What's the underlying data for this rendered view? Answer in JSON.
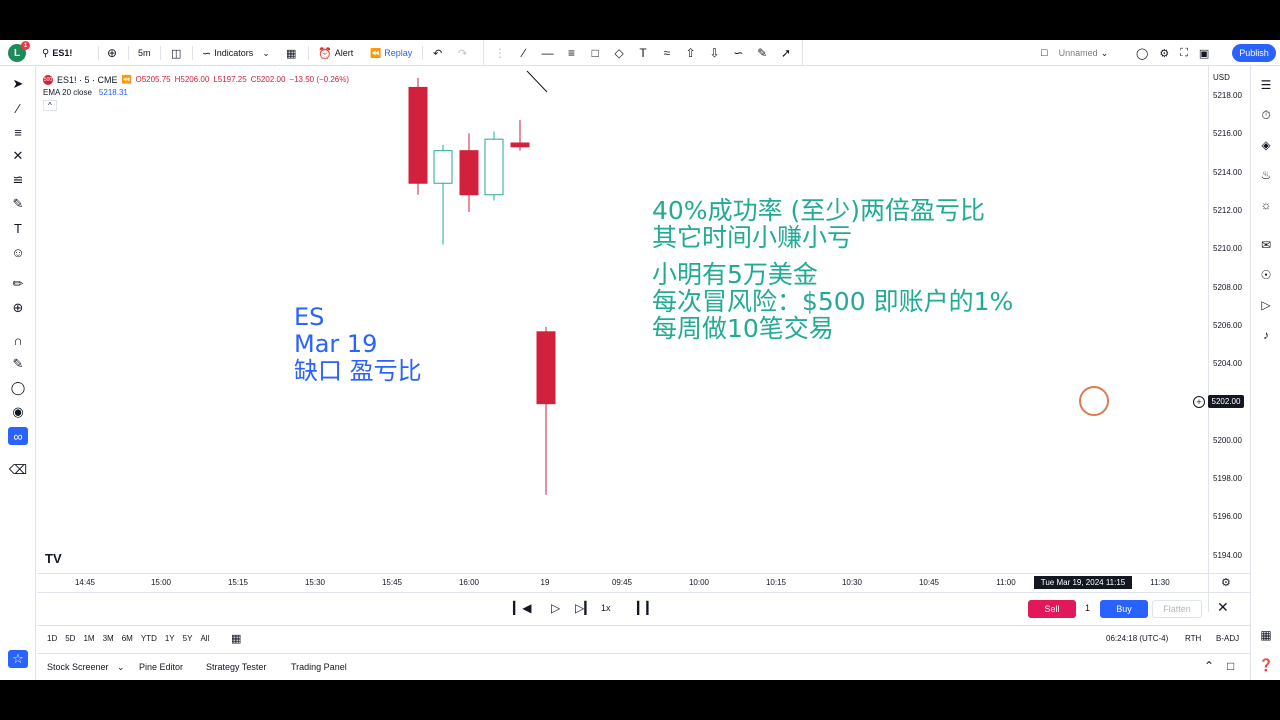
{
  "topbar": {
    "avatar_letter": "L",
    "avatar_badge": "1",
    "symbol": "ES1!",
    "interval": "5m",
    "indicators_label": "Indicators",
    "alert_label": "Alert",
    "replay_label": "Replay",
    "layout_name": "Unnamed",
    "publish_label": "Publish"
  },
  "legend": {
    "symbol_badge": "500",
    "symbol_line": "ES1! · 5 · CME",
    "open": "O5205.75",
    "high": "H5206.00",
    "low": "L5197.25",
    "close": "C5202.00",
    "change": "−13.50 (−0.26%)",
    "ema_label": "EMA 20 close",
    "ema_value": "5218.31",
    "collapse": "^"
  },
  "price_axis": {
    "currency": "USD",
    "ticks": [
      "5218.00",
      "5216.00",
      "5214.00",
      "5212.00",
      "5210.00",
      "5208.00",
      "5206.00",
      "5204.00",
      "5202.00",
      "5200.00",
      "5198.00",
      "5196.00",
      "5194.00"
    ],
    "current_price": "5202.00"
  },
  "time_axis": {
    "ticks": [
      "14:45",
      "15:00",
      "15:15",
      "15:30",
      "15:45",
      "16:00",
      "19",
      "09:45",
      "10:00",
      "10:15",
      "10:30",
      "10:45",
      "11:00",
      "11:15",
      "11:30"
    ],
    "cursor_label": "Tue Mar 19, 2024  11:15"
  },
  "chart_data": {
    "type": "candlestick",
    "price_range": [
      5193,
      5219
    ],
    "candles": [
      {
        "time": "15:55",
        "open": 5218.5,
        "high": 5219.0,
        "low": 5212.9,
        "close": 5213.5
      },
      {
        "time": "16:00",
        "open": 5213.5,
        "high": 5215.5,
        "low": 5210.3,
        "close": 5215.2
      },
      {
        "time": "16:05",
        "open": 5215.2,
        "high": 5216.1,
        "low": 5212.0,
        "close": 5212.9
      },
      {
        "time": "16:10",
        "open": 5212.9,
        "high": 5216.2,
        "low": 5212.6,
        "close": 5215.8
      },
      {
        "time": "16:15",
        "open": 5215.6,
        "high": 5216.8,
        "low": 5215.2,
        "close": 5215.4
      },
      {
        "time": "09:30",
        "open": 5205.75,
        "high": 5206.0,
        "low": 5197.25,
        "close": 5202.0
      }
    ]
  },
  "annotations": {
    "green_lines": [
      "40%成功率 (至少)两倍盈亏比",
      "其它时间小赚小亏",
      "",
      "小明有5万美金",
      "每次冒风险：$500 即账户的1%",
      "每周做10笔交易"
    ],
    "blue_lines": [
      "ES",
      "Mar 19",
      "缺口  盈亏比"
    ]
  },
  "replay": {
    "speed": "1x",
    "sell_label": "Sell",
    "quantity": "1",
    "buy_label": "Buy",
    "flatten_label": "Flatten"
  },
  "ranges": {
    "items": [
      "1D",
      "5D",
      "1M",
      "3M",
      "6M",
      "YTD",
      "1Y",
      "5Y",
      "All"
    ],
    "clock": "06:24:18 (UTC-4)",
    "session": "RTH",
    "adjust": "B-ADJ"
  },
  "bottom_tabs": {
    "items": [
      "Stock Screener",
      "Pine Editor",
      "Strategy Tester",
      "Trading Panel"
    ]
  },
  "colors": {
    "bear": "#d1213c",
    "bull_border": "#22ab94",
    "accent": "#2962ff",
    "note_green": "#22ab94"
  }
}
